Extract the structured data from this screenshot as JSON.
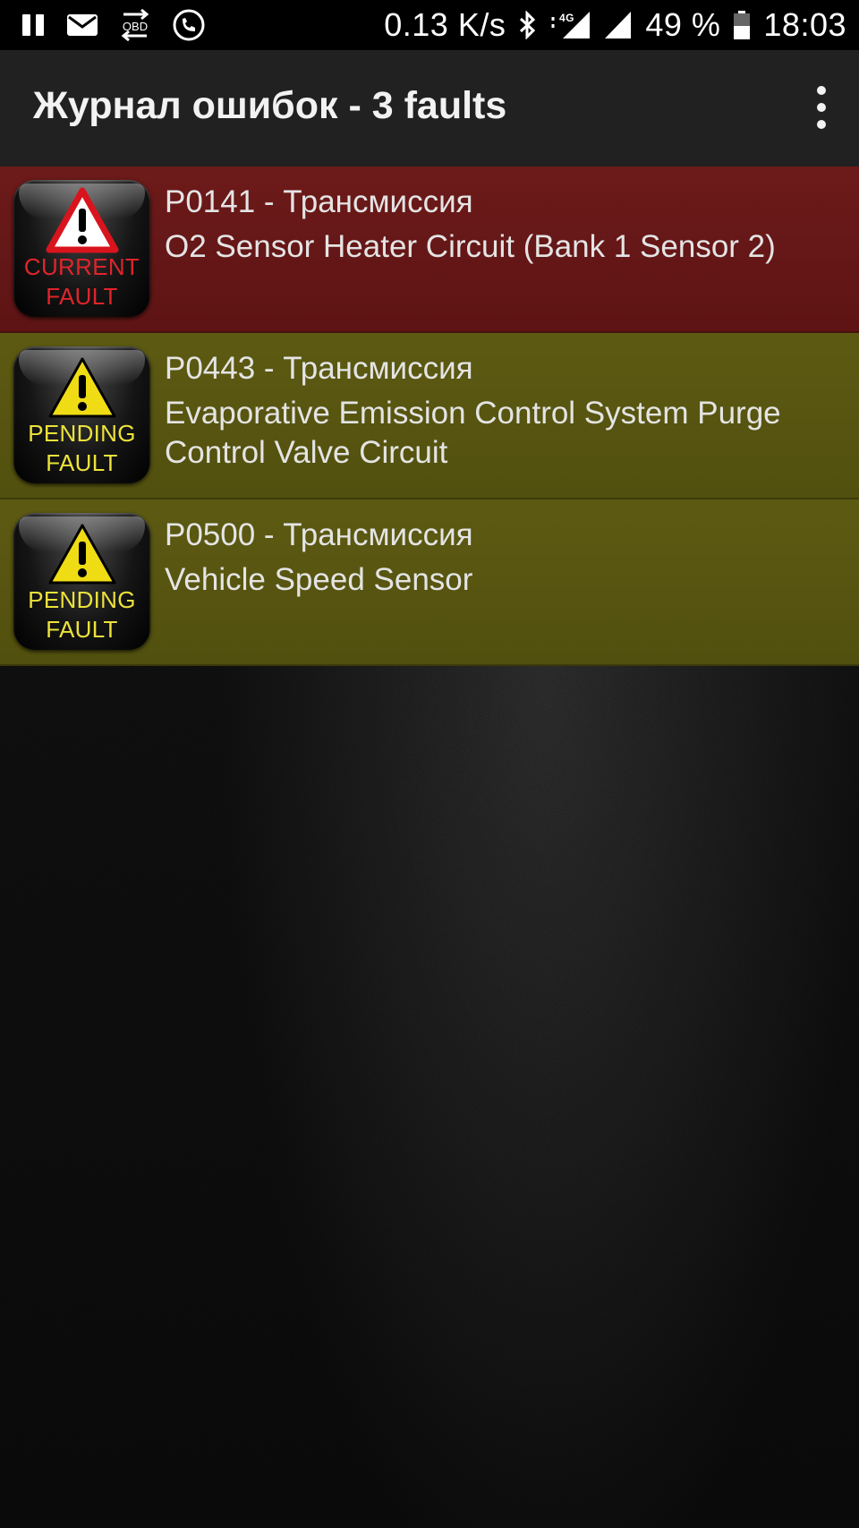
{
  "status_bar": {
    "icons": [
      "pause-icon",
      "mail-icon",
      "obd-icon",
      "phone-sync-icon",
      "bluetooth-icon",
      "signal-4g-icon",
      "signal-icon",
      "battery-icon"
    ],
    "obd_label": "OBD",
    "network_speed": "0.13 K/s",
    "network_type": "4G",
    "battery": "49 %",
    "time": "18:03"
  },
  "app_bar": {
    "title": "Журнал ошибок - 3 faults",
    "menu_icon": "more-vert-icon"
  },
  "faults": [
    {
      "status": "current",
      "badge_line1": "CURRENT",
      "badge_line2": "FAULT",
      "code": "P0141 - Трансмиссия",
      "description": "O2 Sensor Heater Circuit (Bank 1 Sensor 2)"
    },
    {
      "status": "pending",
      "badge_line1": "PENDING",
      "badge_line2": "FAULT",
      "code": "P0443 - Трансмиссия",
      "description": "Evaporative Emission Control System Purge Control Valve Circuit"
    },
    {
      "status": "pending",
      "badge_line1": "PENDING",
      "badge_line2": "FAULT",
      "code": "P0500 - Трансмиссия",
      "description": "Vehicle Speed Sensor"
    }
  ],
  "colors": {
    "current_row": "#6d1a1a",
    "pending_row": "#5c5a12",
    "current_text": "#e0242b",
    "pending_text": "#ece23a",
    "app_bar": "#212121"
  }
}
